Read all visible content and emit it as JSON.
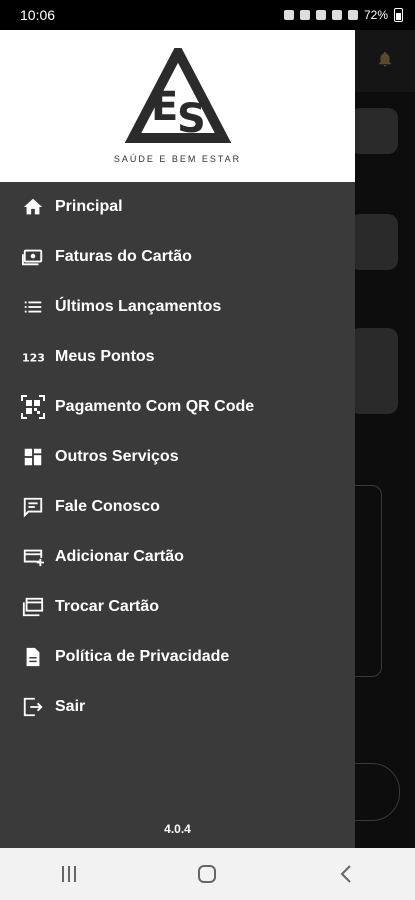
{
  "status_bar": {
    "time": "10:06",
    "battery": "72%"
  },
  "drawer": {
    "brand_tagline": "SAÚDE E BEM ESTAR",
    "menu": [
      {
        "label": "Principal",
        "icon": "home-icon"
      },
      {
        "label": "Faturas do Cartão",
        "icon": "bill-icon"
      },
      {
        "label": "Últimos Lançamentos",
        "icon": "list-icon"
      },
      {
        "label": "Meus Pontos",
        "icon": "numbers-icon"
      },
      {
        "label": "Pagamento Com QR Code",
        "icon": "qr-code-icon"
      },
      {
        "label": "Outros Serviços",
        "icon": "grid-icon"
      },
      {
        "label": "Fale Conosco",
        "icon": "chat-icon"
      },
      {
        "label": "Adicionar Cartão",
        "icon": "add-card-icon"
      },
      {
        "label": "Trocar Cartão",
        "icon": "cards-icon"
      },
      {
        "label": "Política de Privacidade",
        "icon": "document-icon"
      },
      {
        "label": "Sair",
        "icon": "exit-icon"
      }
    ],
    "version": "4.0.4"
  },
  "colors": {
    "drawer_bg": "#3a3a3a",
    "logo_bg": "#ffffff",
    "text": "#ffffff"
  }
}
